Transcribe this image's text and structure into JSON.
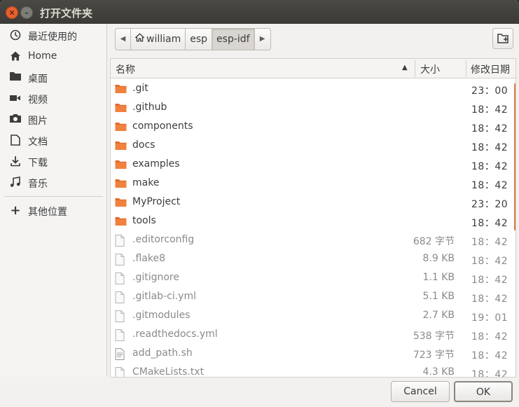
{
  "window": {
    "title": "打开文件夹"
  },
  "sidebar": {
    "items": [
      {
        "label": "最近使用的",
        "icon": "clock-icon"
      },
      {
        "label": "Home",
        "icon": "home-icon"
      },
      {
        "label": "桌面",
        "icon": "folder-icon"
      },
      {
        "label": "视频",
        "icon": "video-camera-icon"
      },
      {
        "label": "图片",
        "icon": "camera-icon"
      },
      {
        "label": "文档",
        "icon": "document-icon"
      },
      {
        "label": "下载",
        "icon": "download-icon"
      },
      {
        "label": "音乐",
        "icon": "music-note-icon"
      }
    ],
    "other": {
      "label": "其他位置",
      "icon": "plus-icon"
    }
  },
  "pathbar": {
    "segments": [
      "william",
      "esp",
      "esp-idf"
    ],
    "active": "esp-idf"
  },
  "columns": {
    "name": "名称",
    "size": "大小",
    "modified": "修改日期"
  },
  "files": [
    {
      "name": ".git",
      "type": "folder",
      "size": "",
      "modified": "23：00"
    },
    {
      "name": ".github",
      "type": "folder",
      "size": "",
      "modified": "18：42"
    },
    {
      "name": "components",
      "type": "folder",
      "size": "",
      "modified": "18：42"
    },
    {
      "name": "docs",
      "type": "folder",
      "size": "",
      "modified": "18：42"
    },
    {
      "name": "examples",
      "type": "folder",
      "size": "",
      "modified": "18：42"
    },
    {
      "name": "make",
      "type": "folder",
      "size": "",
      "modified": "18：42"
    },
    {
      "name": "MyProject",
      "type": "folder",
      "size": "",
      "modified": "23：20"
    },
    {
      "name": "tools",
      "type": "folder",
      "size": "",
      "modified": "18：42"
    },
    {
      "name": ".editorconfig",
      "type": "file",
      "size": "682 字节",
      "modified": "18：42"
    },
    {
      "name": ".flake8",
      "type": "file",
      "size": "8.9 KB",
      "modified": "18：42"
    },
    {
      "name": ".gitignore",
      "type": "file",
      "size": "1.1 KB",
      "modified": "18：42"
    },
    {
      "name": ".gitlab-ci.yml",
      "type": "file",
      "size": "5.1 KB",
      "modified": "18：42"
    },
    {
      "name": ".gitmodules",
      "type": "file",
      "size": "2.7 KB",
      "modified": "19：01"
    },
    {
      "name": ".readthedocs.yml",
      "type": "file",
      "size": "538 字节",
      "modified": "18：42"
    },
    {
      "name": "add_path.sh",
      "type": "script",
      "size": "723 字节",
      "modified": "18：42"
    },
    {
      "name": "CMakeLists.txt",
      "type": "file",
      "size": "4.3 KB",
      "modified": "18：42"
    }
  ],
  "buttons": {
    "cancel": "Cancel",
    "ok": "OK"
  },
  "colors": {
    "folder": "#e36a2a",
    "accent": "#e07a44",
    "titlebar": "#3b3a36",
    "close": "#e7602e"
  }
}
